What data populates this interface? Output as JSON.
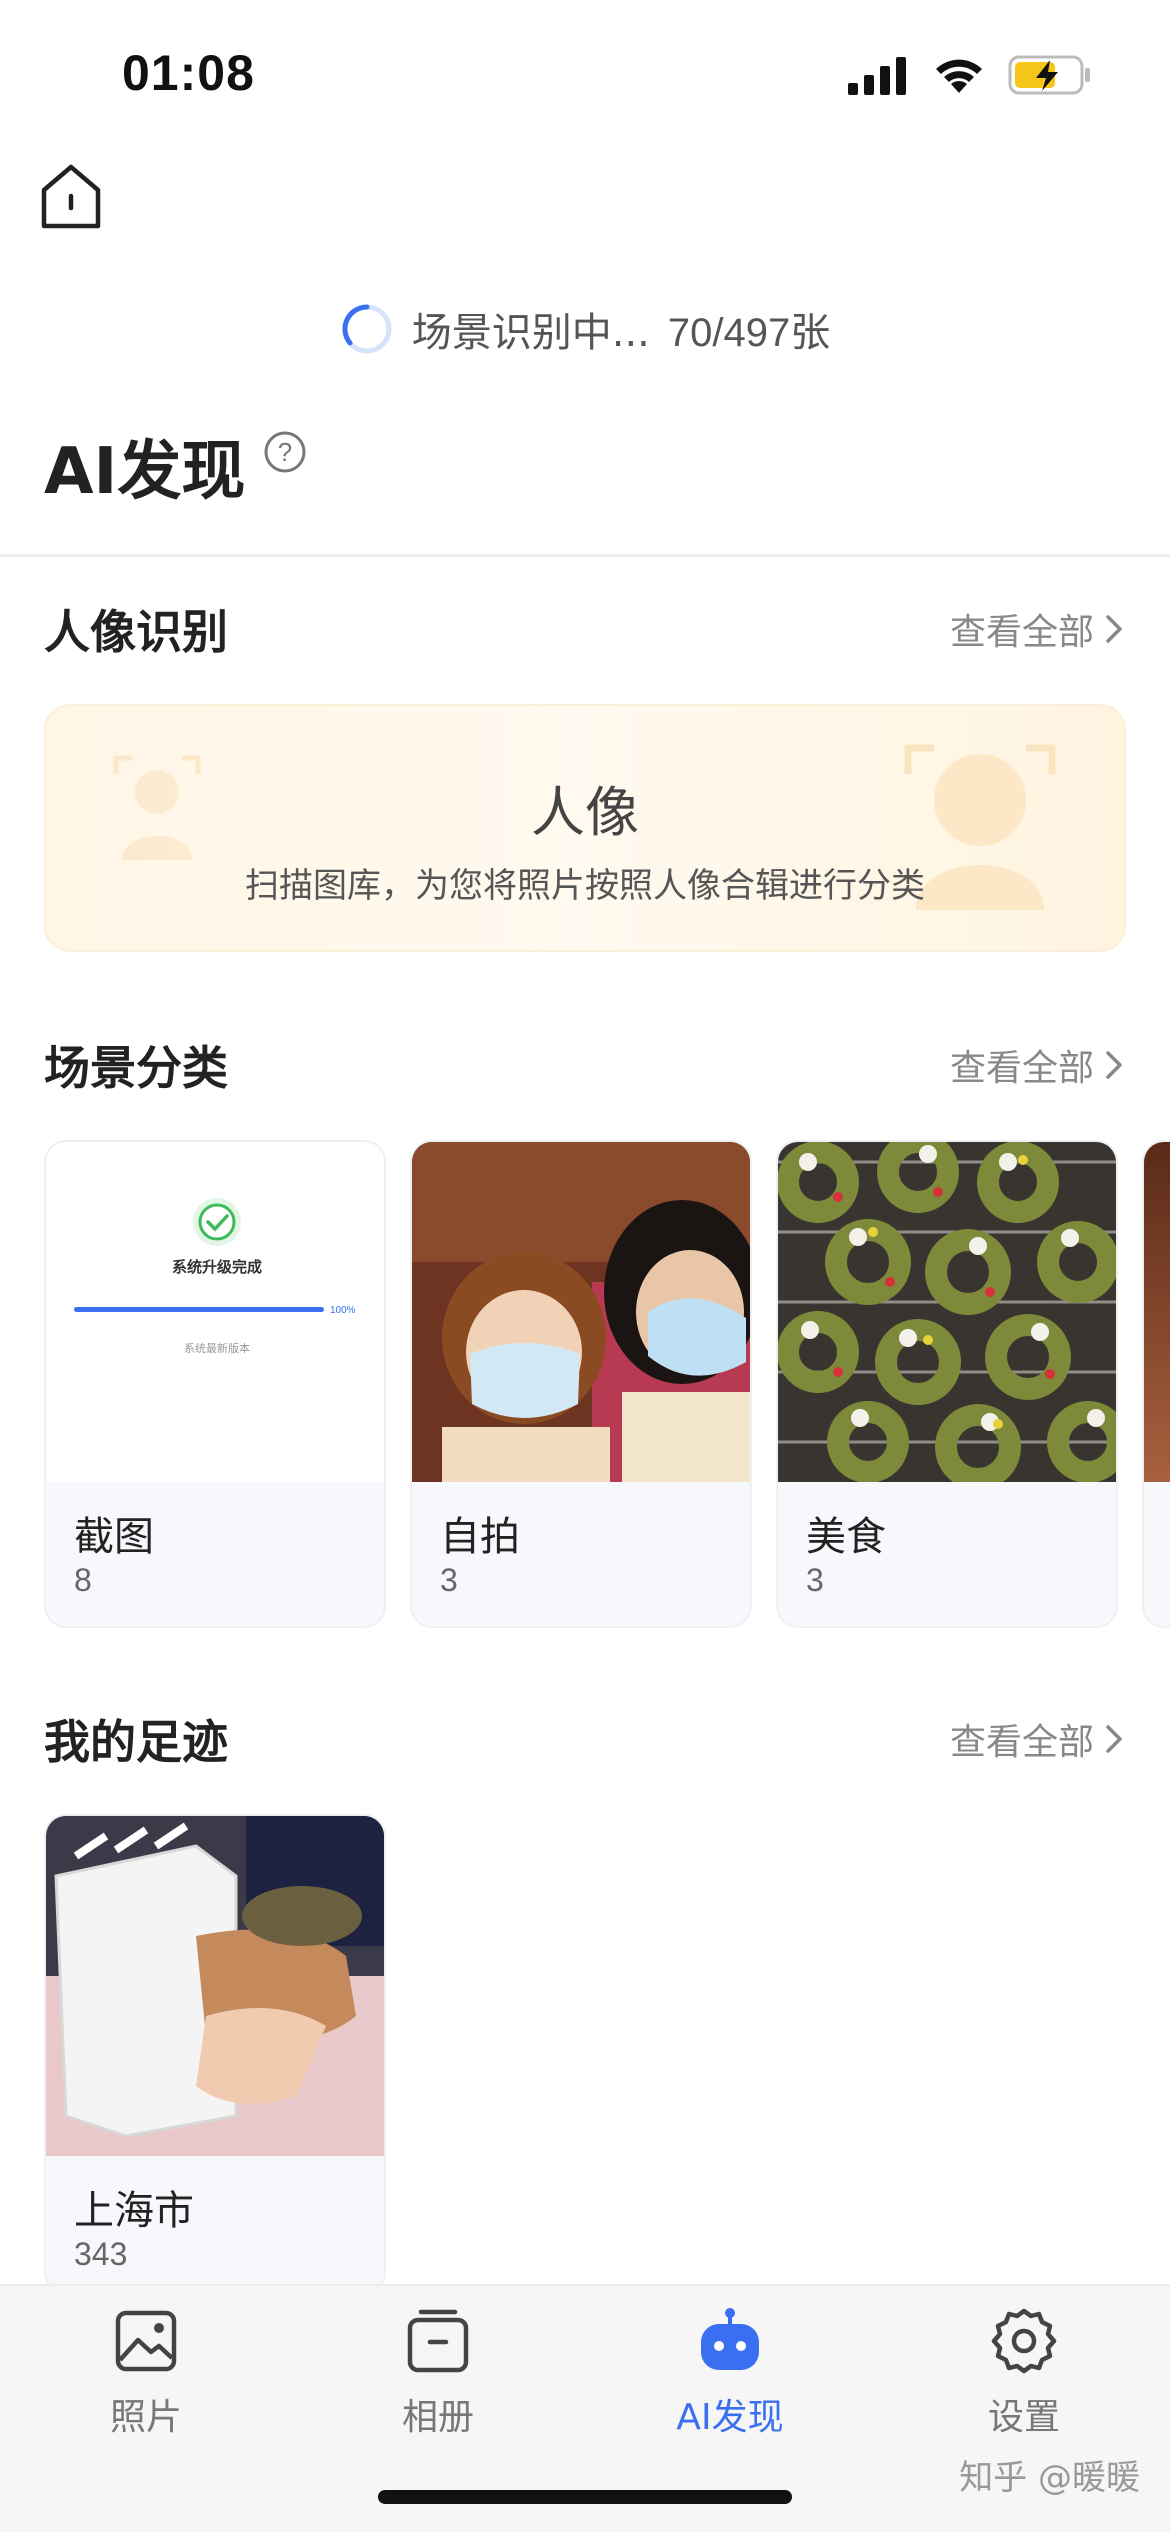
{
  "status_bar": {
    "time": "01:08"
  },
  "scan": {
    "text": "场景识别中...",
    "count": "70/497张"
  },
  "page": {
    "title": "AI发现",
    "help": "?"
  },
  "portrait_section": {
    "title": "人像识别",
    "view_all": "查看全部",
    "card_title": "人像",
    "card_desc": "扫描图库，为您将照片按照人像合辑进行分类"
  },
  "scene_section": {
    "title": "场景分类",
    "view_all": "查看全部",
    "items": [
      {
        "name": "截图",
        "count": "8",
        "thumb_title": "系统升级完成",
        "thumb_sub": "系统最新版本",
        "thumb_percent": "100%"
      },
      {
        "name": "自拍",
        "count": "3"
      },
      {
        "name": "美食",
        "count": "3"
      }
    ]
  },
  "footprint_section": {
    "title": "我的足迹",
    "view_all": "查看全部",
    "items": [
      {
        "name": "上海市",
        "count": "343"
      }
    ]
  },
  "tabs": [
    {
      "label": "照片",
      "icon": "photo-icon",
      "active": false
    },
    {
      "label": "相册",
      "icon": "album-icon",
      "active": false
    },
    {
      "label": "AI发现",
      "icon": "robot-icon",
      "active": true
    },
    {
      "label": "设置",
      "icon": "gear-icon",
      "active": false
    }
  ],
  "watermark": "知乎 @暖暖",
  "colors": {
    "accent": "#3a6ff2",
    "portrait_bg": "#fff6e6",
    "battery": "#f5c518"
  }
}
